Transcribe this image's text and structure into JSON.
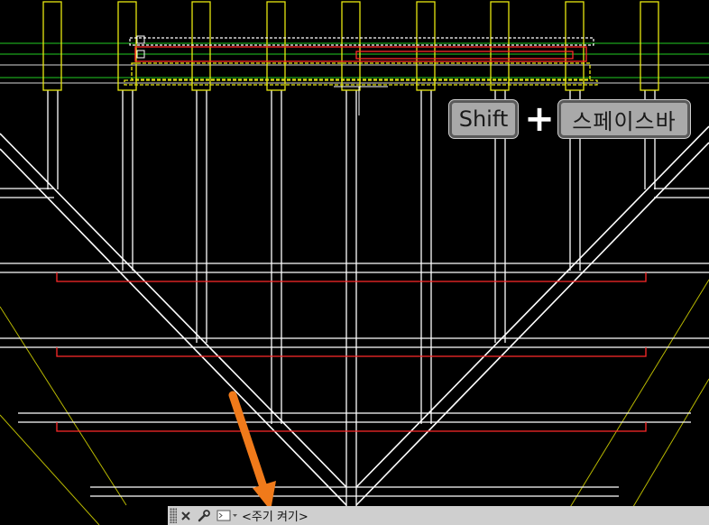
{
  "shortcut": {
    "key1": "Shift",
    "plus": "+",
    "key2": "스페이스바"
  },
  "command_line": {
    "text": "<주기 켜기>",
    "close_icon": "close-icon",
    "customize_icon": "wrench-icon",
    "prompt_icon": "command-prompt-icon"
  },
  "colors": {
    "background": "#000000",
    "structure_lines": "#ffffff",
    "highlight_lines": "#ff2a2a",
    "accent_lines": "#e8e810",
    "green_lines": "#22cc22",
    "arrow": "#f07a1a",
    "command_bar": "#cfcfcf"
  }
}
